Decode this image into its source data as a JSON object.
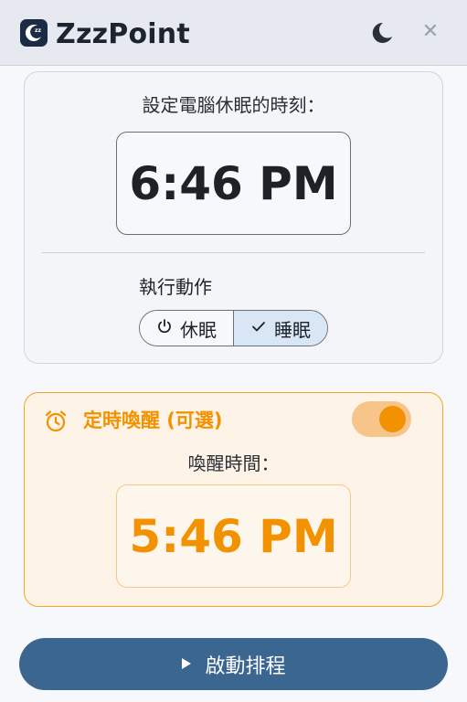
{
  "app": {
    "title": "ZzzPoint",
    "icons": {
      "logo": "zzz-moon-logo",
      "theme": "moon-icon",
      "close": "close-icon"
    }
  },
  "sleep": {
    "label": "設定電腦休眠的時刻：",
    "time": "6:46 PM"
  },
  "action": {
    "label": "執行動作",
    "options": [
      {
        "label": "休眠",
        "icon": "power-icon",
        "selected": false
      },
      {
        "label": "睡眠",
        "icon": "check-icon",
        "selected": true
      }
    ]
  },
  "wake": {
    "title": "定時喚醒 (可選)",
    "enabled": true,
    "label": "喚醒時間：",
    "time": "5:46 PM",
    "accent": "#f39200"
  },
  "start": {
    "label": "啟動排程"
  },
  "colors": {
    "primary": "#3a6690",
    "accent": "#f39200",
    "segment_selected": "#d9e6f5"
  }
}
